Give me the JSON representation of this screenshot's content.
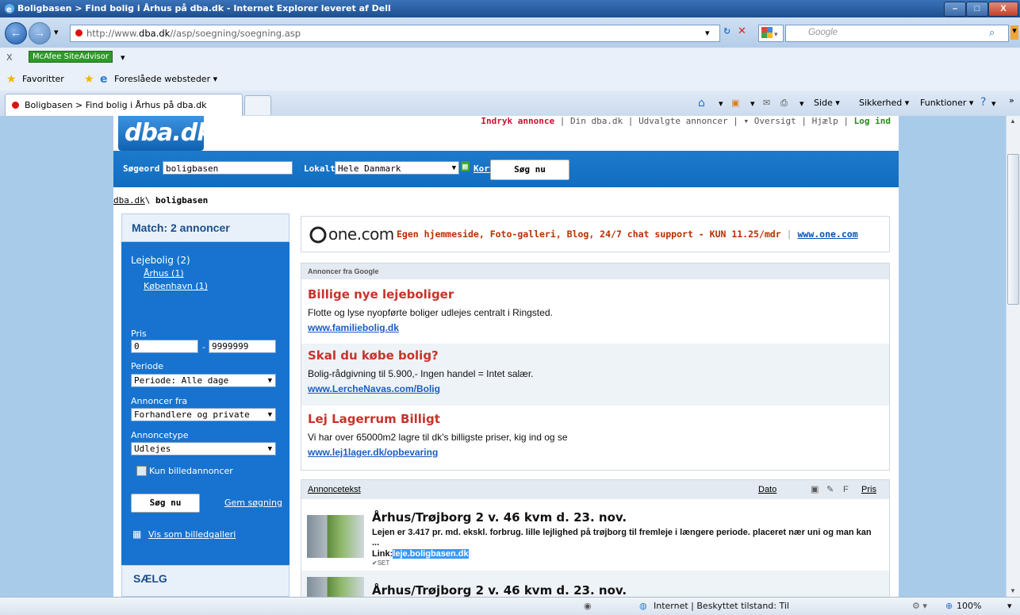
{
  "window": {
    "title": "Boligbasen > Find bolig i Århus på dba.dk - Internet Explorer leveret af Dell",
    "min": "–",
    "max": "□",
    "close": "X"
  },
  "address": {
    "url_pre": "http://www.",
    "url_domain": "dba.dk",
    "url_post": "//asp/soegning/soegning.asp",
    "search_placeholder": "Google"
  },
  "toolbar": {
    "close_x": "X",
    "mcafee": "McAfee SiteAdvisor",
    "favorites": "Favoritter",
    "suggested": "Foreslåede websteder ▾",
    "tab_title": "Boligbasen > Find bolig i Århus på dba.dk",
    "side": "Side ▾",
    "security": "Sikkerhed ▾",
    "functions": "Funktioner ▾",
    "more": "»"
  },
  "site": {
    "logo": "dba.dk",
    "toplinks": {
      "post_ad": "Indryk annonce",
      "my": "Din dba.dk",
      "selected": "Udvalgte annoncer",
      "overview": "▾ Oversigt",
      "help": "Hjælp",
      "login": "Log ind"
    },
    "search": {
      "keyword_label": "Søgeord",
      "keyword_value": "boligbasen",
      "local_label": "Lokalt",
      "local_value": "Hele Danmark",
      "map_link": "Kort",
      "button": "Søg nu"
    },
    "breadcrumb": {
      "root": "dba.dk",
      "sep": "\\",
      "current": "boligbasen"
    }
  },
  "sidebar": {
    "match": "Match: 2 annoncer",
    "category": "Lejebolig",
    "category_count": "(2)",
    "sub1": "Århus (1)",
    "sub2": "København (1)",
    "price_label": "Pris",
    "price_from": "0",
    "price_dash": "-",
    "price_to": "9999999",
    "period_label": "Periode",
    "period_value": "Periode: Alle dage",
    "from_label": "Annoncer fra",
    "from_value": "Forhandlere og private",
    "type_label": "Annoncetype",
    "type_value": "Udlejes",
    "images_only": "Kun billedannoncer",
    "search_button": "Søg nu",
    "save_search": "Gem søgning",
    "gallery": "Vis som billedgalleri",
    "sell": "SÆLG"
  },
  "promo": {
    "logo": "one.com",
    "text": "Egen hjemmeside, Foto-galleri, Blog, 24/7 chat support - KUN 11.25/mdr",
    "sep": "|",
    "link": "www.one.com"
  },
  "google_ads": {
    "header": "Annoncer fra Google",
    "items": [
      {
        "title": "Billige nye lejeboliger",
        "desc": "Flotte og lyse nyopførte boliger udlejes centralt i Ringsted.",
        "link": "www.familiebolig.dk"
      },
      {
        "title": "Skal du købe bolig?",
        "desc": "Bolig-rådgivning til 5.900,- Ingen handel = Intet salær.",
        "link": "www.LercheNavas.com/Bolig"
      },
      {
        "title": "Lej Lagerrum Billigt",
        "desc": "Vi har over 65000m2 lagre til dk's billigste priser, kig ind og se",
        "link": "www.lej1lager.dk/opbevaring"
      }
    ]
  },
  "listing": {
    "col_text": "Annoncetekst",
    "col_date": "Dato",
    "col_f": "F",
    "col_price": "Pris",
    "rows": [
      {
        "title": "Århus/Trøjborg 2 v. 46 kvm d. 23. nov.",
        "desc": "Lejen er 3.417 pr. md. ekskl. forbrug. lille lejlighed på trøjborg til fremleje i længere periode. placeret nær uni og man kan ...",
        "link_label": "Link:",
        "link": "leje.boligbasen.dk",
        "seen": "✔SET"
      },
      {
        "title": "Århus/Trøjborg 2 v. 46 kvm d. 23. nov."
      }
    ]
  },
  "statusbar": {
    "zone": "Internet | Beskyttet tilstand: Til",
    "zoom": "100%"
  },
  "colors": {
    "brand_blue": "#1773cf",
    "ad_red": "#c8332b",
    "link_blue": "#1a5dc2",
    "login_green": "#2a8a1e"
  }
}
